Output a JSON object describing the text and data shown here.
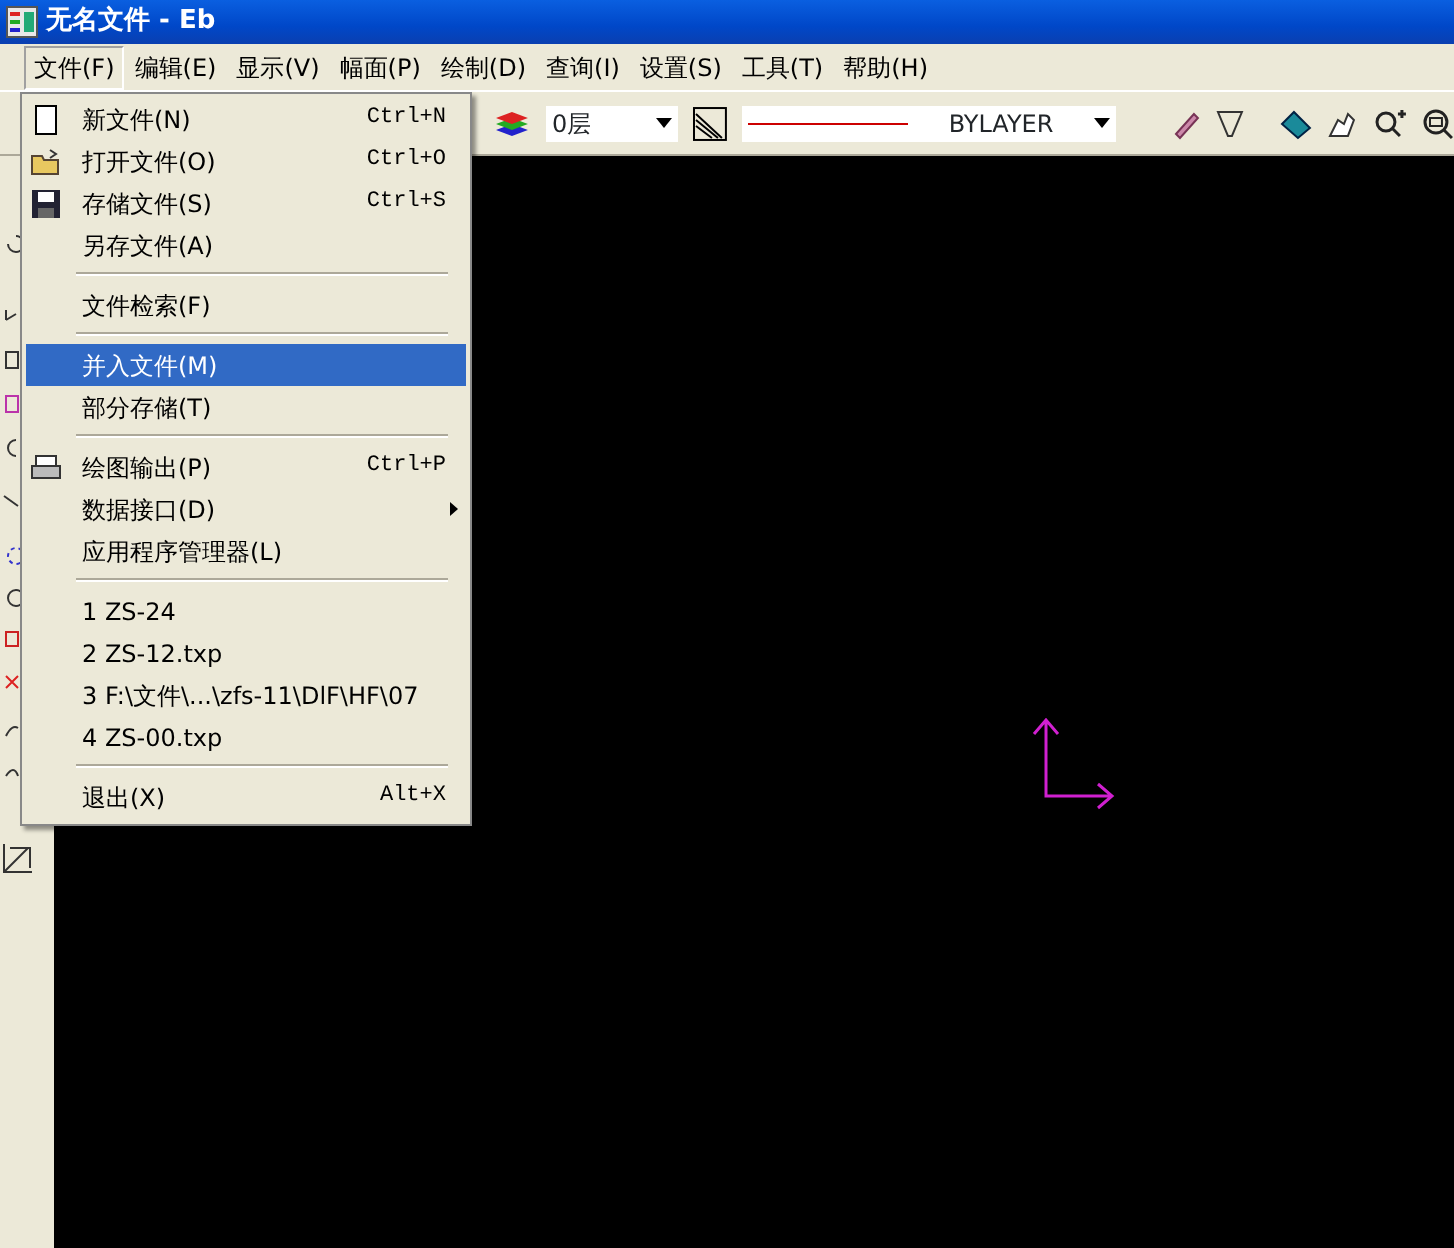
{
  "window": {
    "title": "无名文件 - Eb"
  },
  "menubar": {
    "items": [
      {
        "label": "文件(F)",
        "selected": true
      },
      {
        "label": "编辑(E)",
        "selected": false
      },
      {
        "label": "显示(V)",
        "selected": false
      },
      {
        "label": "幅面(P)",
        "selected": false
      },
      {
        "label": "绘制(D)",
        "selected": false
      },
      {
        "label": "查询(I)",
        "selected": false
      },
      {
        "label": "设置(S)",
        "selected": false
      },
      {
        "label": "工具(T)",
        "selected": false
      },
      {
        "label": "帮助(H)",
        "selected": false
      }
    ]
  },
  "toolbar": {
    "layer_field": {
      "value": "0层"
    },
    "linetype_field": {
      "value": "BYLAYER"
    }
  },
  "file_menu": {
    "items": [
      {
        "kind": "item",
        "label": "新文件(N)",
        "shortcut": "Ctrl+N",
        "selected": false
      },
      {
        "kind": "item",
        "label": "打开文件(O)",
        "shortcut": "Ctrl+O",
        "selected": false
      },
      {
        "kind": "item",
        "label": "存储文件(S)",
        "shortcut": "Ctrl+S",
        "selected": false
      },
      {
        "kind": "item",
        "label": "另存文件(A)",
        "selected": false
      },
      {
        "kind": "separator"
      },
      {
        "kind": "item",
        "label": "文件检索(F)",
        "selected": false
      },
      {
        "kind": "separator"
      },
      {
        "kind": "item",
        "label": "并入文件(M)",
        "selected": true
      },
      {
        "kind": "item",
        "label": "部分存储(T)",
        "selected": false
      },
      {
        "kind": "separator"
      },
      {
        "kind": "item",
        "label": "绘图输出(P)",
        "shortcut": "Ctrl+P",
        "selected": false
      },
      {
        "kind": "item",
        "label": "数据接口(D)",
        "submenu": true,
        "selected": false
      },
      {
        "kind": "item",
        "label": "应用程序管理器(L)",
        "selected": false
      },
      {
        "kind": "separator"
      },
      {
        "kind": "item",
        "label": "1 ZS-24",
        "selected": false
      },
      {
        "kind": "item",
        "label": "2 ZS-12.txp",
        "selected": false
      },
      {
        "kind": "item",
        "label": "3 F:\\文件\\...\\zfs-11\\DlF\\HF\\07",
        "selected": false
      },
      {
        "kind": "item",
        "label": "4 ZS-00.txp",
        "selected": false
      },
      {
        "kind": "separator"
      },
      {
        "kind": "item",
        "label": "退出(X)",
        "shortcut": "Alt+X",
        "selected": false
      }
    ]
  }
}
